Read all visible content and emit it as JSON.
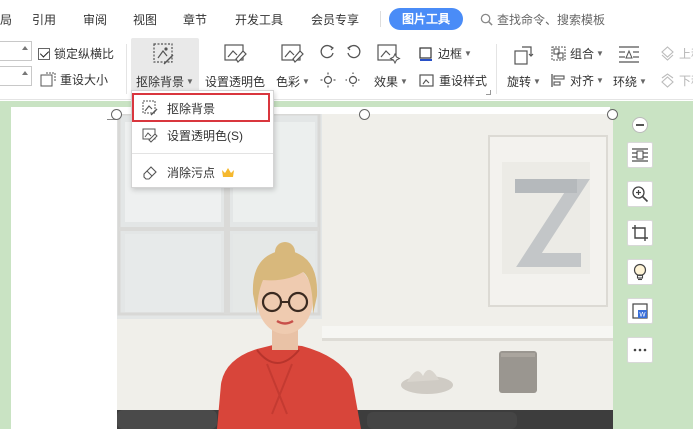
{
  "menubar": {
    "tabs": [
      "局",
      "引用",
      "审阅",
      "视图",
      "章节",
      "开发工具",
      "会员专享"
    ],
    "active_tab": "图片工具",
    "search_placeholder": "查找命令、搜索模板"
  },
  "ribbon": {
    "lock_ratio_label": "锁定纵横比",
    "reset_size_label": "重设大小",
    "remove_bg_label": "抠除背景",
    "set_transparent_label": "设置透明色",
    "color_label": "色彩",
    "effect_label": "效果",
    "border_label": "边框",
    "reset_style_label": "重设样式",
    "rotate_label": "旋转",
    "group_label": "组合",
    "align_label": "对齐",
    "wrap_label": "环绕",
    "up_label": "上移",
    "down_label": "下移"
  },
  "dropdown": {
    "items": [
      {
        "label": "抠除背景",
        "icon": "remove-background-icon"
      },
      {
        "label": "设置透明色(S)",
        "icon": "transparent-color-icon"
      },
      {
        "label": "消除污点",
        "icon": "eraser-icon",
        "badge": "crown-icon"
      }
    ]
  },
  "colors": {
    "accent": "#4a8cf7",
    "highlight": "#d9363e",
    "workspace_bg": "#c9e3c3",
    "crown": "#f5b82e"
  }
}
